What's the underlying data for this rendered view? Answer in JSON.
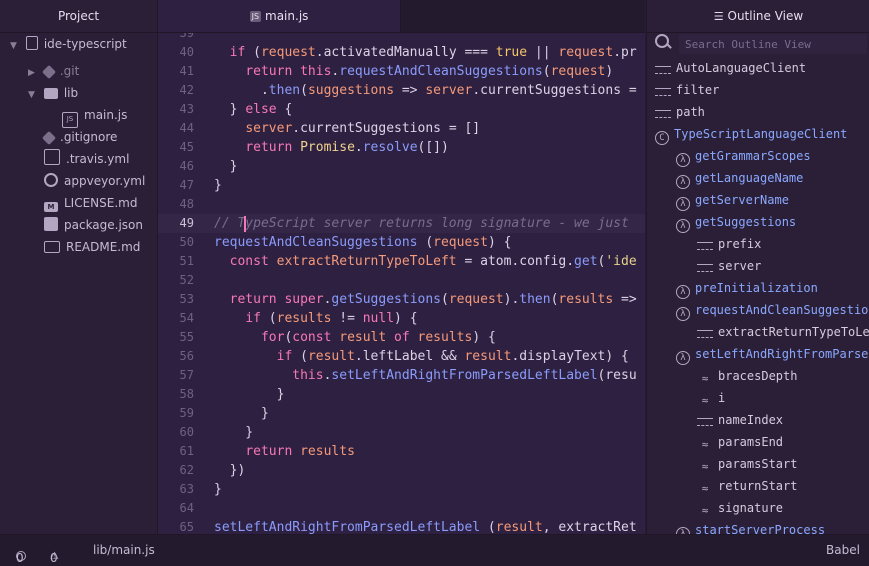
{
  "project_panel": {
    "title": "Project",
    "items": [
      {
        "label": "ide-typescript",
        "icon": "repo-icon"
      },
      {
        "label": ".git",
        "icon": "git-icon"
      },
      {
        "label": "lib",
        "icon": "folder-icon"
      },
      {
        "label": "main.js",
        "icon": "js-file-icon"
      },
      {
        "label": ".gitignore",
        "icon": "git-icon"
      },
      {
        "label": ".travis.yml",
        "icon": "travis-icon"
      },
      {
        "label": "appveyor.yml",
        "icon": "appveyor-icon"
      },
      {
        "label": "LICENSE.md",
        "icon": "markdown-icon"
      },
      {
        "label": "package.json",
        "icon": "npm-icon"
      },
      {
        "label": "README.md",
        "icon": "book-icon"
      }
    ]
  },
  "editor": {
    "tab_label": "main.js",
    "tab_badge": "JS",
    "lines": [
      {
        "n": "39",
        "text": ""
      },
      {
        "n": "40",
        "text": "  if (request.activatedManually === true || request.pr"
      },
      {
        "n": "41",
        "text": "    return this.requestAndCleanSuggestions(request)"
      },
      {
        "n": "42",
        "text": "      .then(suggestions => server.currentSuggestions ="
      },
      {
        "n": "43",
        "text": "  } else {"
      },
      {
        "n": "44",
        "text": "    server.currentSuggestions = []"
      },
      {
        "n": "45",
        "text": "    return Promise.resolve([])"
      },
      {
        "n": "46",
        "text": "  }"
      },
      {
        "n": "47",
        "text": "}"
      },
      {
        "n": "48",
        "text": ""
      },
      {
        "n": "49",
        "text": "// TypeScript server returns long signature - we just"
      },
      {
        "n": "50",
        "text": "requestAndCleanSuggestions (request) {"
      },
      {
        "n": "51",
        "text": "  const extractReturnTypeToLeft = atom.config.get('ide"
      },
      {
        "n": "52",
        "text": ""
      },
      {
        "n": "53",
        "text": "  return super.getSuggestions(request).then(results =>"
      },
      {
        "n": "54",
        "text": "    if (results != null) {"
      },
      {
        "n": "55",
        "text": "      for(const result of results) {"
      },
      {
        "n": "56",
        "text": "        if (result.leftLabel && result.displayText) {"
      },
      {
        "n": "57",
        "text": "          this.setLeftAndRightFromParsedLeftLabel(resu"
      },
      {
        "n": "58",
        "text": "        }"
      },
      {
        "n": "59",
        "text": "      }"
      },
      {
        "n": "60",
        "text": "    }"
      },
      {
        "n": "61",
        "text": "    return results"
      },
      {
        "n": "62",
        "text": "  })"
      },
      {
        "n": "63",
        "text": "}"
      },
      {
        "n": "64",
        "text": ""
      },
      {
        "n": "65",
        "text": "setLeftAndRightFromParsedLeftLabel (result, extractRet"
      }
    ]
  },
  "outline": {
    "title": "Outline View",
    "search_placeholder": "Search Outline View",
    "items": [
      {
        "label": "AutoLanguageClient",
        "kind": "prop",
        "level": 0
      },
      {
        "label": "filter",
        "kind": "prop",
        "level": 0
      },
      {
        "label": "path",
        "kind": "prop",
        "level": 0
      },
      {
        "label": "TypeScriptLanguageClient",
        "kind": "class",
        "level": 0
      },
      {
        "label": "getGrammarScopes",
        "kind": "method",
        "level": 1
      },
      {
        "label": "getLanguageName",
        "kind": "method",
        "level": 1
      },
      {
        "label": "getServerName",
        "kind": "method",
        "level": 1
      },
      {
        "label": "getSuggestions",
        "kind": "method",
        "level": 1
      },
      {
        "label": "prefix",
        "kind": "prop",
        "level": 2
      },
      {
        "label": "server",
        "kind": "prop",
        "level": 2
      },
      {
        "label": "preInitialization",
        "kind": "method",
        "level": 1
      },
      {
        "label": "requestAndCleanSuggestion",
        "kind": "method",
        "level": 1
      },
      {
        "label": "extractReturnTypeToLef",
        "kind": "prop",
        "level": 2
      },
      {
        "label": "setLeftAndRightFromParsed",
        "kind": "method",
        "level": 1
      },
      {
        "label": "bracesDepth",
        "kind": "var",
        "level": 2
      },
      {
        "label": "i",
        "kind": "var",
        "level": 2
      },
      {
        "label": "nameIndex",
        "kind": "prop",
        "level": 2
      },
      {
        "label": "paramsEnd",
        "kind": "var",
        "level": 2
      },
      {
        "label": "paramsStart",
        "kind": "var",
        "level": 2
      },
      {
        "label": "returnStart",
        "kind": "var",
        "level": 2
      },
      {
        "label": "signature",
        "kind": "var",
        "level": 2
      },
      {
        "label": "startServerProcess",
        "kind": "method",
        "level": 1
      }
    ]
  },
  "status": {
    "errors": "0",
    "warnings": "0",
    "file_path": "lib/main.js",
    "grammar": "Babel"
  }
}
